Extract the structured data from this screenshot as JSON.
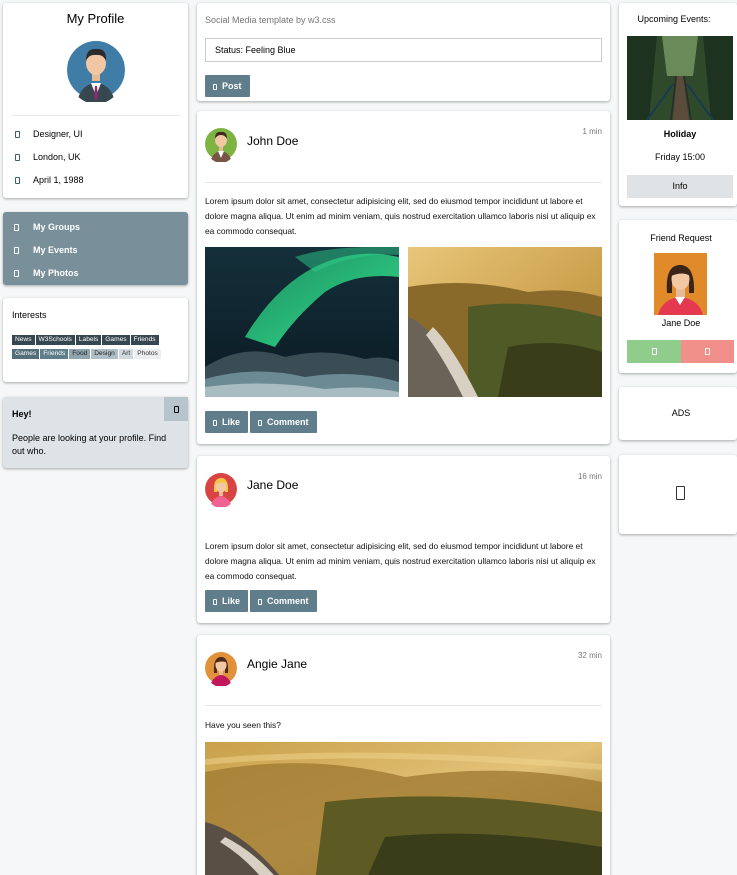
{
  "profile": {
    "title": "My Profile",
    "details": [
      {
        "icon": "pencil-icon",
        "text": "Designer, UI"
      },
      {
        "icon": "home-icon",
        "text": "London, UK"
      },
      {
        "icon": "birthday-cake-icon",
        "text": "April 1, 1988"
      }
    ]
  },
  "nav": {
    "items": [
      {
        "icon": "circle-icon",
        "label": "My Groups"
      },
      {
        "icon": "calendar-icon",
        "label": "My Events"
      },
      {
        "icon": "users-icon",
        "label": "My Photos"
      }
    ]
  },
  "interests": {
    "title": "Interests",
    "tags": [
      {
        "label": "News",
        "style": "dark"
      },
      {
        "label": "W3Schools",
        "style": "dark"
      },
      {
        "label": "Labels",
        "style": "dark"
      },
      {
        "label": "Games",
        "style": "dark"
      },
      {
        "label": "Friends",
        "style": "dark"
      },
      {
        "label": "Games",
        "style": "mid"
      },
      {
        "label": "Friends",
        "style": "mid"
      },
      {
        "label": "Food",
        "style": "light"
      },
      {
        "label": "Design",
        "style": "light"
      },
      {
        "label": "Art",
        "style": "lighter"
      },
      {
        "label": "Photos",
        "style": "lighter"
      }
    ]
  },
  "alert": {
    "title": "Hey!",
    "text": "People are looking at your profile. Find out who."
  },
  "composer": {
    "caption": "Social Media template by w3.css",
    "status_value": "Status: Feeling Blue",
    "post_label": "Post"
  },
  "posts": [
    {
      "author": "John Doe",
      "time": "1 min",
      "text": "Lorem ipsum dolor sit amet, consectetur adipisicing elit, sed do eiusmod tempor incididunt ut labore et dolore magna aliqua. Ut enim ad minim veniam, quis nostrud exercitation ullamco laboris nisi ut aliquip ex ea commodo consequat.",
      "like": "Like",
      "comment": "Comment"
    },
    {
      "author": "Jane Doe",
      "time": "16 min",
      "text": "Lorem ipsum dolor sit amet, consectetur adipisicing elit, sed do eiusmod tempor incididunt ut labore et dolore magna aliqua. Ut enim ad minim veniam, quis nostrud exercitation ullamco laboris nisi ut aliquip ex ea commodo consequat.",
      "like": "Like",
      "comment": "Comment"
    },
    {
      "author": "Angie Jane",
      "time": "32 min",
      "text": "Have you seen this?"
    }
  ],
  "events": {
    "title": "Upcoming Events:",
    "name": "Holiday",
    "when": "Friday 15:00",
    "info_label": "Info"
  },
  "friend_request": {
    "title": "Friend Request",
    "name": "Jane Doe"
  },
  "ads": {
    "label": "ADS"
  },
  "colors": {
    "accent": "#607d8b",
    "nav_bg": "#798f9a",
    "accept": "#90cc8c",
    "decline": "#f1908a"
  }
}
